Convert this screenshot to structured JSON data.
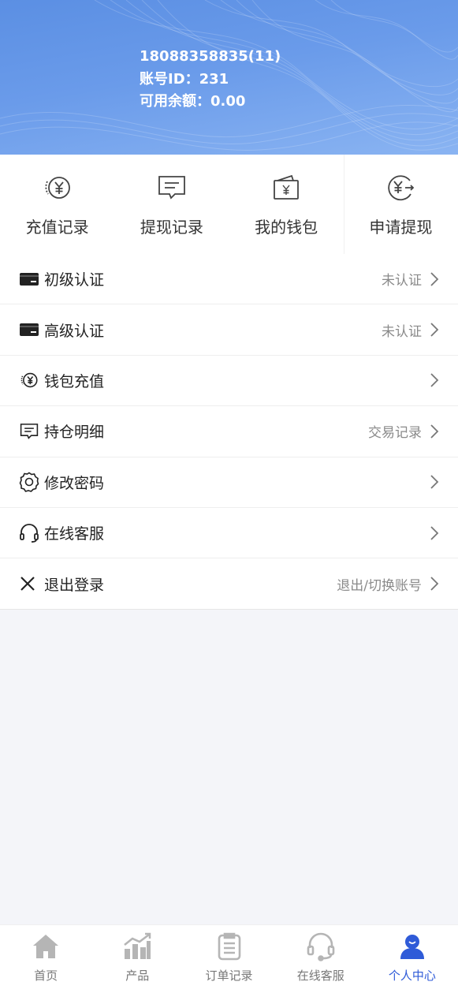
{
  "header": {
    "phone": "18088358835(11)",
    "account_id": "账号ID：231",
    "balance": "可用余额：0.00"
  },
  "quick_actions": [
    {
      "label": "充值记录",
      "icon": "recharge-yen-icon"
    },
    {
      "label": "提现记录",
      "icon": "message-icon"
    },
    {
      "label": "我的钱包",
      "icon": "wallet-icon"
    },
    {
      "label": "申请提现",
      "icon": "withdraw-yen-icon"
    }
  ],
  "menu": [
    {
      "label": "初级认证",
      "right": "未认证",
      "icon": "card-icon"
    },
    {
      "label": "高级认证",
      "right": "未认证",
      "icon": "card-icon"
    },
    {
      "label": "钱包充值",
      "right": "",
      "icon": "recharge-yen-icon"
    },
    {
      "label": "持仓明细",
      "right": "交易记录",
      "icon": "message-icon"
    },
    {
      "label": "修改密码",
      "right": "",
      "icon": "gear-icon"
    },
    {
      "label": "在线客服",
      "right": "",
      "icon": "headset-icon"
    },
    {
      "label": "退出登录",
      "right": "退出/切换账号",
      "icon": "close-icon"
    }
  ],
  "tabbar": [
    {
      "label": "首页",
      "icon": "home-icon",
      "active": false
    },
    {
      "label": "产品",
      "icon": "chart-icon",
      "active": false
    },
    {
      "label": "订单记录",
      "icon": "clipboard-icon",
      "active": false
    },
    {
      "label": "在线客服",
      "icon": "headset-icon",
      "active": false
    },
    {
      "label": "个人中心",
      "icon": "user-icon",
      "active": true
    }
  ],
  "colors": {
    "header_gradient_start": "#5b8fe3",
    "header_gradient_end": "#8ab4f2",
    "active_tab": "#2f5bd8",
    "inactive_tab_icon": "#b5b5b5"
  }
}
